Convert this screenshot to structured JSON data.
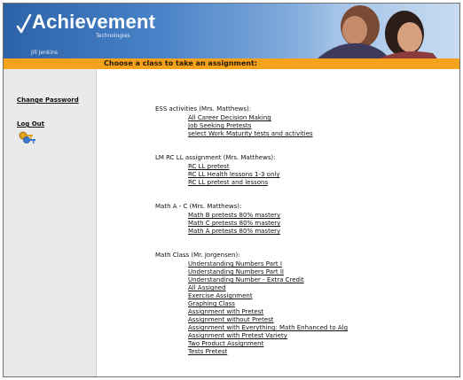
{
  "header": {
    "logo_main": "Achievement",
    "logo_sub": "Technologies",
    "user_text": "Jill Jenkins",
    "instruction": "Choose a class to take an assignment:"
  },
  "sidebar": {
    "change_password": "Change Password",
    "logout": "Log Out"
  },
  "classes": [
    {
      "title": "ESS activities (Mrs. Matthews):",
      "items": [
        "All Career Decision Making",
        "Job Seeking Pretests",
        "select Work Maturity tests and activities"
      ]
    },
    {
      "title": "LM RC LL assignment (Mrs. Matthews):",
      "items": [
        "RC LL pretest",
        "RC LL Health lessons 1-3 only",
        "RC LL pretest and lessons"
      ]
    },
    {
      "title": "Math A - C (Mrs. Matthews):",
      "items": [
        "Math B pretests 80% mastery",
        "Math C pretests 80% mastery",
        "Math A pretests 80% mastery"
      ]
    },
    {
      "title": "Math Class (Mr. Jorgensen):",
      "items": [
        "Understanding Numbers Part I",
        "Understanding Numbers Part II",
        "Understanding Number - Extra Credit",
        "All Assigned",
        "Exercise Assignment",
        "Graphing Class",
        "Assignment with Pretest",
        "Assignment without Pretest",
        "Assignment with Everything: Math Enhanced to Alg",
        "Assignment with Pretest Variety",
        "Two Product Assignment",
        "Tests Pretest"
      ]
    }
  ],
  "colors": {
    "banner": "#2c62a8",
    "instruction_bar": "#f4a11c",
    "sidebar": "#eaeaea"
  }
}
